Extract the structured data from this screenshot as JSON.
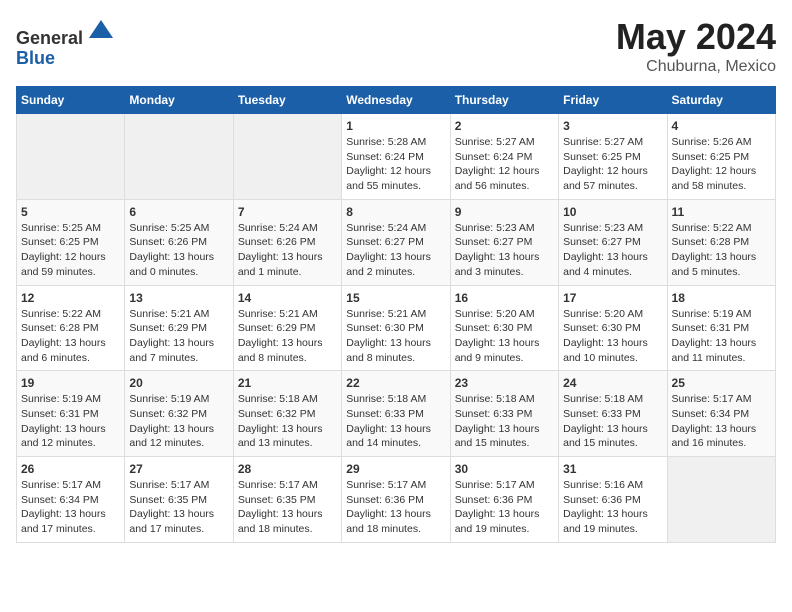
{
  "header": {
    "logo_line1": "General",
    "logo_line2": "Blue",
    "main_title": "May 2024",
    "subtitle": "Chuburna, Mexico"
  },
  "days_of_week": [
    "Sunday",
    "Monday",
    "Tuesday",
    "Wednesday",
    "Thursday",
    "Friday",
    "Saturday"
  ],
  "weeks": [
    [
      {
        "day": "",
        "info": ""
      },
      {
        "day": "",
        "info": ""
      },
      {
        "day": "",
        "info": ""
      },
      {
        "day": "1",
        "info": "Sunrise: 5:28 AM\nSunset: 6:24 PM\nDaylight: 12 hours\nand 55 minutes."
      },
      {
        "day": "2",
        "info": "Sunrise: 5:27 AM\nSunset: 6:24 PM\nDaylight: 12 hours\nand 56 minutes."
      },
      {
        "day": "3",
        "info": "Sunrise: 5:27 AM\nSunset: 6:25 PM\nDaylight: 12 hours\nand 57 minutes."
      },
      {
        "day": "4",
        "info": "Sunrise: 5:26 AM\nSunset: 6:25 PM\nDaylight: 12 hours\nand 58 minutes."
      }
    ],
    [
      {
        "day": "5",
        "info": "Sunrise: 5:25 AM\nSunset: 6:25 PM\nDaylight: 12 hours\nand 59 minutes."
      },
      {
        "day": "6",
        "info": "Sunrise: 5:25 AM\nSunset: 6:26 PM\nDaylight: 13 hours\nand 0 minutes."
      },
      {
        "day": "7",
        "info": "Sunrise: 5:24 AM\nSunset: 6:26 PM\nDaylight: 13 hours\nand 1 minute."
      },
      {
        "day": "8",
        "info": "Sunrise: 5:24 AM\nSunset: 6:27 PM\nDaylight: 13 hours\nand 2 minutes."
      },
      {
        "day": "9",
        "info": "Sunrise: 5:23 AM\nSunset: 6:27 PM\nDaylight: 13 hours\nand 3 minutes."
      },
      {
        "day": "10",
        "info": "Sunrise: 5:23 AM\nSunset: 6:27 PM\nDaylight: 13 hours\nand 4 minutes."
      },
      {
        "day": "11",
        "info": "Sunrise: 5:22 AM\nSunset: 6:28 PM\nDaylight: 13 hours\nand 5 minutes."
      }
    ],
    [
      {
        "day": "12",
        "info": "Sunrise: 5:22 AM\nSunset: 6:28 PM\nDaylight: 13 hours\nand 6 minutes."
      },
      {
        "day": "13",
        "info": "Sunrise: 5:21 AM\nSunset: 6:29 PM\nDaylight: 13 hours\nand 7 minutes."
      },
      {
        "day": "14",
        "info": "Sunrise: 5:21 AM\nSunset: 6:29 PM\nDaylight: 13 hours\nand 8 minutes."
      },
      {
        "day": "15",
        "info": "Sunrise: 5:21 AM\nSunset: 6:30 PM\nDaylight: 13 hours\nand 8 minutes."
      },
      {
        "day": "16",
        "info": "Sunrise: 5:20 AM\nSunset: 6:30 PM\nDaylight: 13 hours\nand 9 minutes."
      },
      {
        "day": "17",
        "info": "Sunrise: 5:20 AM\nSunset: 6:30 PM\nDaylight: 13 hours\nand 10 minutes."
      },
      {
        "day": "18",
        "info": "Sunrise: 5:19 AM\nSunset: 6:31 PM\nDaylight: 13 hours\nand 11 minutes."
      }
    ],
    [
      {
        "day": "19",
        "info": "Sunrise: 5:19 AM\nSunset: 6:31 PM\nDaylight: 13 hours\nand 12 minutes."
      },
      {
        "day": "20",
        "info": "Sunrise: 5:19 AM\nSunset: 6:32 PM\nDaylight: 13 hours\nand 12 minutes."
      },
      {
        "day": "21",
        "info": "Sunrise: 5:18 AM\nSunset: 6:32 PM\nDaylight: 13 hours\nand 13 minutes."
      },
      {
        "day": "22",
        "info": "Sunrise: 5:18 AM\nSunset: 6:33 PM\nDaylight: 13 hours\nand 14 minutes."
      },
      {
        "day": "23",
        "info": "Sunrise: 5:18 AM\nSunset: 6:33 PM\nDaylight: 13 hours\nand 15 minutes."
      },
      {
        "day": "24",
        "info": "Sunrise: 5:18 AM\nSunset: 6:33 PM\nDaylight: 13 hours\nand 15 minutes."
      },
      {
        "day": "25",
        "info": "Sunrise: 5:17 AM\nSunset: 6:34 PM\nDaylight: 13 hours\nand 16 minutes."
      }
    ],
    [
      {
        "day": "26",
        "info": "Sunrise: 5:17 AM\nSunset: 6:34 PM\nDaylight: 13 hours\nand 17 minutes."
      },
      {
        "day": "27",
        "info": "Sunrise: 5:17 AM\nSunset: 6:35 PM\nDaylight: 13 hours\nand 17 minutes."
      },
      {
        "day": "28",
        "info": "Sunrise: 5:17 AM\nSunset: 6:35 PM\nDaylight: 13 hours\nand 18 minutes."
      },
      {
        "day": "29",
        "info": "Sunrise: 5:17 AM\nSunset: 6:36 PM\nDaylight: 13 hours\nand 18 minutes."
      },
      {
        "day": "30",
        "info": "Sunrise: 5:17 AM\nSunset: 6:36 PM\nDaylight: 13 hours\nand 19 minutes."
      },
      {
        "day": "31",
        "info": "Sunrise: 5:16 AM\nSunset: 6:36 PM\nDaylight: 13 hours\nand 19 minutes."
      },
      {
        "day": "",
        "info": ""
      }
    ]
  ]
}
